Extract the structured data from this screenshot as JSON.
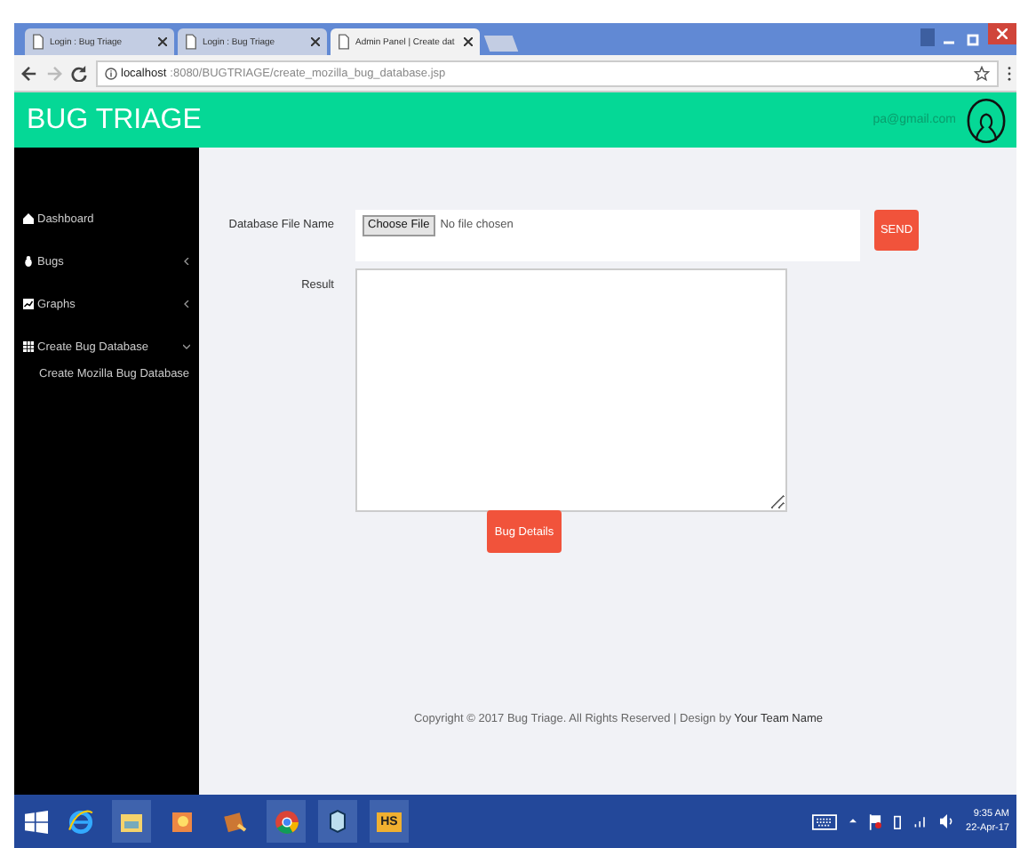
{
  "browser": {
    "tabs": [
      {
        "label": "Login : Bug Triage",
        "selected": false
      },
      {
        "label": "Login : Bug Triage",
        "selected": false
      },
      {
        "label": "Admin Panel | Create dat",
        "selected": true
      }
    ],
    "url_host": "localhost",
    "url_path": ":8080/BUGTRIAGE/create_mozilla_bug_database.jsp"
  },
  "header": {
    "title": "BUG TRIAGE",
    "email": "pa@gmail.com"
  },
  "sidebar": {
    "items": [
      {
        "label": "Dashboard",
        "kind": "link"
      },
      {
        "label": "Bugs",
        "kind": "menu",
        "expanded": false
      },
      {
        "label": "Graphs",
        "kind": "menu",
        "expanded": false
      },
      {
        "label": "Create Bug Database",
        "kind": "menu",
        "expanded": true,
        "children": [
          {
            "label": "Create Mozilla Bug Database"
          }
        ]
      }
    ]
  },
  "form": {
    "file_label": "Database File Name",
    "file_button": "Choose File",
    "file_status": "No file chosen",
    "send_button": "SEND",
    "result_label": "Result",
    "details_button": "Bug Details"
  },
  "footer": {
    "text": "Copyright © 2017 Bug Triage. All Rights Reserved | Design by",
    "link": "Your Team Name"
  },
  "taskbar": {
    "apps": [
      {
        "kind": "ie",
        "active": false
      },
      {
        "kind": "explorer",
        "active": true
      },
      {
        "kind": "media",
        "active": false
      },
      {
        "kind": "video",
        "active": false
      },
      {
        "kind": "chrome",
        "active": true
      },
      {
        "kind": "box",
        "active": true
      },
      {
        "kind": "hs",
        "active": true,
        "label": "HS"
      }
    ],
    "time": "9:35 AM",
    "date": "22-Apr-17"
  }
}
